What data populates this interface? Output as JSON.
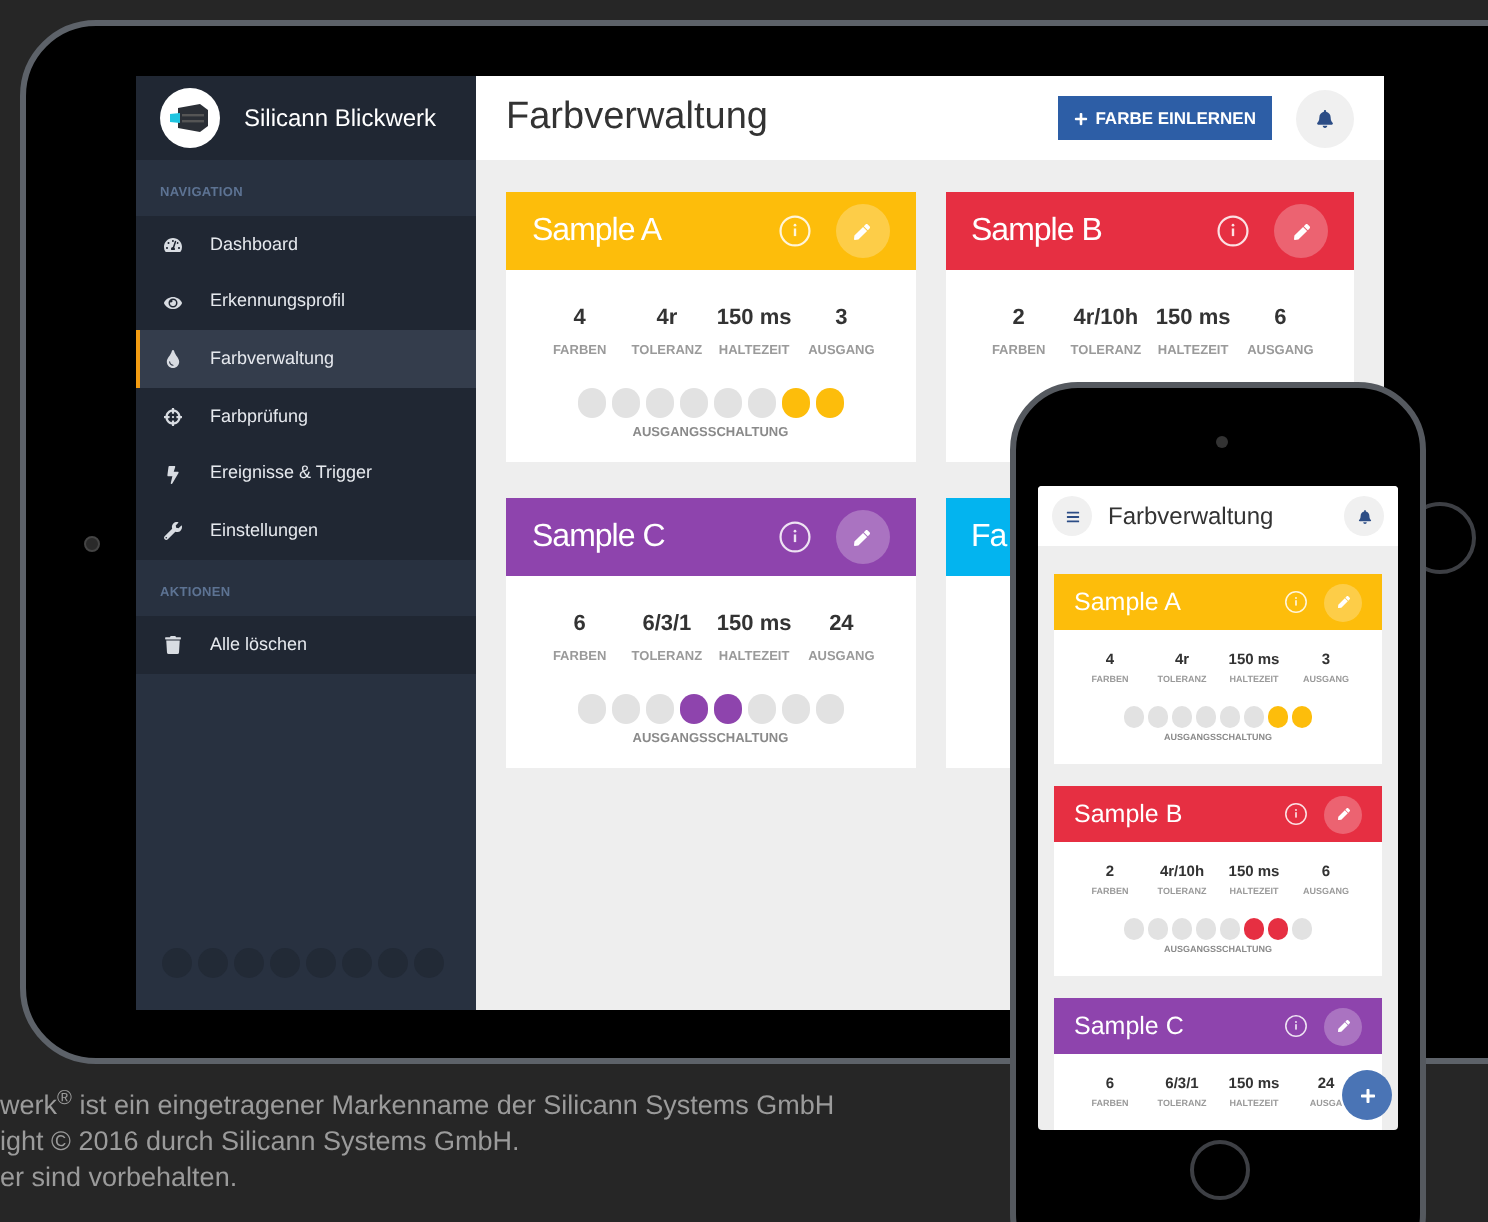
{
  "tablet": {
    "sidebar": {
      "brand": "Silicann Blickwerk",
      "sections": [
        {
          "heading": "NAVIGATION",
          "items": [
            {
              "label": "Dashboard",
              "selected": false
            },
            {
              "label": "Erkennungsprofil",
              "selected": false
            },
            {
              "label": "Farbverwaltung",
              "selected": true
            },
            {
              "label": "Farbprüfung",
              "selected": false
            },
            {
              "label": "Ereignisse & Trigger",
              "selected": false
            },
            {
              "label": "Einstellungen",
              "selected": false
            }
          ]
        },
        {
          "heading": "AKTIONEN",
          "items": [
            {
              "label": "Alle löschen",
              "selected": false
            }
          ]
        }
      ]
    },
    "header": {
      "title": "Farbverwaltung",
      "button": "FARBE EINLERNEN"
    },
    "cards": [
      {
        "title": "Sample A",
        "color": "#fdbd0b",
        "stats": [
          {
            "value": "4",
            "label": "FARBEN"
          },
          {
            "value": "4r",
            "label": "TOLERANZ"
          },
          {
            "value": "150 ms",
            "label": "HALTEZEIT"
          },
          {
            "value": "3",
            "label": "AUSGANG"
          }
        ],
        "circuit": [
          {
            "on": false
          },
          {
            "on": false
          },
          {
            "on": false
          },
          {
            "on": false
          },
          {
            "on": false
          },
          {
            "on": false
          },
          {
            "on": true
          },
          {
            "on": true
          }
        ],
        "circuit_label": "AUSGANGSSCHALTUNG"
      },
      {
        "title": "Sample B",
        "color": "#e62f42",
        "stats": [
          {
            "value": "2",
            "label": "FARBEN"
          },
          {
            "value": "4r/10h",
            "label": "TOLERANZ"
          },
          {
            "value": "150 ms",
            "label": "HALTEZEIT"
          },
          {
            "value": "6",
            "label": "AUSGANG"
          }
        ]
      },
      {
        "title": "Sample C",
        "color": "#8e44ad",
        "stats": [
          {
            "value": "6",
            "label": "FARBEN"
          },
          {
            "value": "6/3/1",
            "label": "TOLERANZ"
          },
          {
            "value": "150 ms",
            "label": "HALTEZEIT"
          },
          {
            "value": "24",
            "label": "AUSGANG"
          }
        ],
        "circuit": [
          {
            "on": false
          },
          {
            "on": false
          },
          {
            "on": false
          },
          {
            "on": true
          },
          {
            "on": true
          },
          {
            "on": false
          },
          {
            "on": false
          },
          {
            "on": false
          }
        ],
        "circuit_label": "AUSGANGSSCHALTUNG"
      },
      {
        "title": "Fa",
        "color": "#03b4ef"
      }
    ]
  },
  "phone": {
    "header": {
      "title": "Farbverwaltung"
    },
    "cards": [
      {
        "title": "Sample A",
        "color": "#fdbd0b",
        "stats": [
          {
            "value": "4",
            "label": "FARBEN"
          },
          {
            "value": "4r",
            "label": "TOLERANZ"
          },
          {
            "value": "150 ms",
            "label": "HALTEZEIT"
          },
          {
            "value": "3",
            "label": "AUSGANG"
          }
        ],
        "circuit": [
          {
            "on": false
          },
          {
            "on": false
          },
          {
            "on": false
          },
          {
            "on": false
          },
          {
            "on": false
          },
          {
            "on": false
          },
          {
            "on": true
          },
          {
            "on": true
          }
        ],
        "circuit_label": "AUSGANGSSCHALTUNG"
      },
      {
        "title": "Sample B",
        "color": "#e62f42",
        "stats": [
          {
            "value": "2",
            "label": "FARBEN"
          },
          {
            "value": "4r/10h",
            "label": "TOLERANZ"
          },
          {
            "value": "150 ms",
            "label": "HALTEZEIT"
          },
          {
            "value": "6",
            "label": "AUSGANG"
          }
        ],
        "circuit": [
          {
            "on": false
          },
          {
            "on": false
          },
          {
            "on": false
          },
          {
            "on": false
          },
          {
            "on": false
          },
          {
            "on": true
          },
          {
            "on": true
          },
          {
            "on": false
          }
        ],
        "circuit_label": "AUSGANGSSCHALTUNG"
      },
      {
        "title": "Sample C",
        "color": "#8e44ad",
        "stats": [
          {
            "value": "6",
            "label": "FARBEN"
          },
          {
            "value": "6/3/1",
            "label": "TOLERANZ"
          },
          {
            "value": "150 ms",
            "label": "HALTEZEIT"
          },
          {
            "value": "24",
            "label": "AUSGA"
          }
        ]
      }
    ]
  },
  "footer": [
    "werk$^{®}$ ist ein eingetragener Markenname der Silicann Systems GmbH",
    "ight © 2016 durch Silicann Systems GmbH.",
    "er sind vorbehalten."
  ]
}
